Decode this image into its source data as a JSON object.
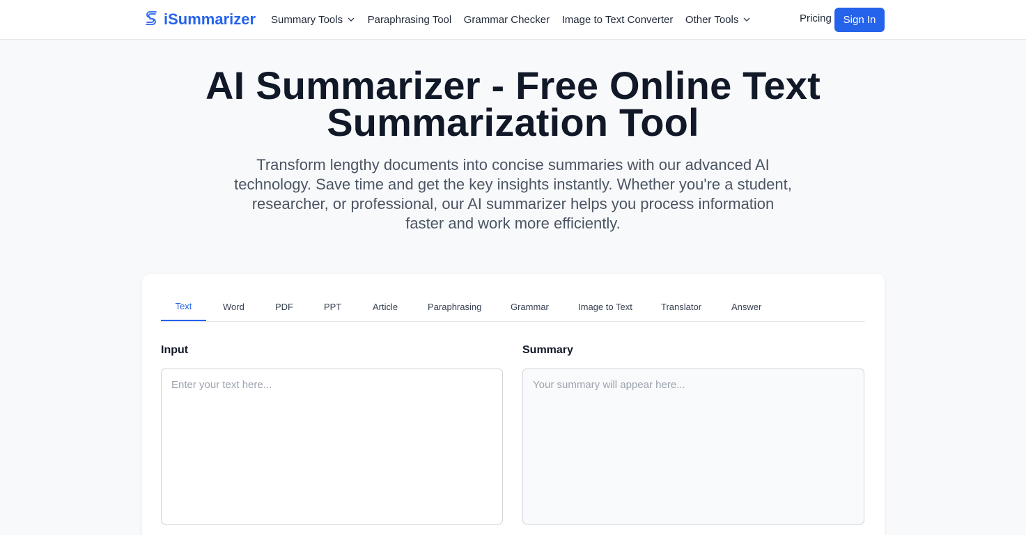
{
  "header": {
    "brand": "iSummarizer",
    "nav": [
      {
        "label": "Summary Tools",
        "has_dropdown": true
      },
      {
        "label": "Paraphrasing Tool",
        "has_dropdown": false
      },
      {
        "label": "Grammar Checker",
        "has_dropdown": false
      },
      {
        "label": "Image to Text Converter",
        "has_dropdown": false
      },
      {
        "label": "Other Tools",
        "has_dropdown": true
      }
    ],
    "pricing": "Pricing",
    "sign_in": "Sign In"
  },
  "hero": {
    "title_line1": "AI Summarizer - Free Online Text",
    "title_line2": "Summarization Tool",
    "subtitle": "Transform lengthy documents into concise summaries with our advanced AI technology. Save time and get the key insights instantly. Whether you're a student, researcher, or professional, our AI summarizer helps you process information faster and work more efficiently."
  },
  "tool": {
    "tabs": [
      "Text",
      "Word",
      "PDF",
      "PPT",
      "Article",
      "Paraphrasing",
      "Grammar",
      "Image to Text",
      "Translator",
      "Answer"
    ],
    "active_tab": "Text",
    "input_label": "Input",
    "input_placeholder": "Enter your text here...",
    "input_value": "",
    "summary_label": "Summary",
    "summary_placeholder": "Your summary will appear here..."
  },
  "icons": {
    "logo": "stacked-s-logo-icon",
    "dropdown": "chevron-down-icon"
  },
  "colors": {
    "brand": "#2563eb",
    "background": "#f8f9fb",
    "text": "#111827",
    "muted": "#4b5563"
  }
}
